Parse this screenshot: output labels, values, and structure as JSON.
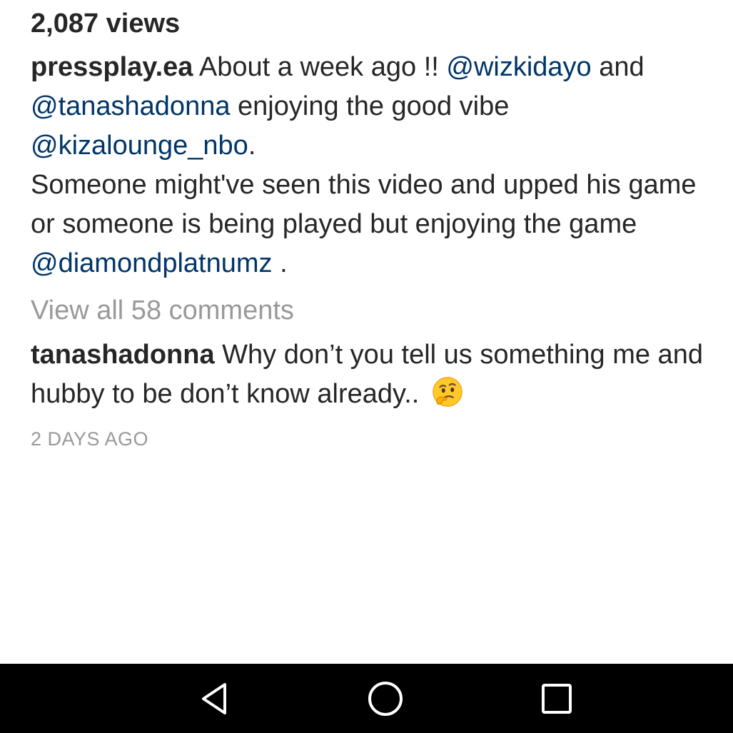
{
  "post": {
    "views": "2,087 views",
    "caption": {
      "username": "pressplay.ea",
      "text_1": " About a week ago !! ",
      "mention_1": "@wizkidayo",
      "text_2": " and ",
      "mention_2": "@tanashadonna",
      "text_3": " enjoying the good vibe ",
      "mention_3": "@kizalounge_nbo",
      "text_4": ".",
      "text_5": "Someone might've seen this video and upped his game or someone is being played but enjoying the game ",
      "mention_4": "@diamondplatnumz",
      "text_6": " ."
    },
    "view_all_comments": "View all 58 comments",
    "top_comment": {
      "username": "tanashadonna",
      "text": " Why don’t you tell us something me and hubby to be don’t know already.. ",
      "emoji": "thinking-face-emoji"
    },
    "timestamp": "2 DAYS AGO"
  },
  "navbar": {
    "back": "back-triangle-icon",
    "home": "home-circle-icon",
    "recents": "recents-square-icon"
  },
  "colors": {
    "text": "#262626",
    "mention": "#003569",
    "muted": "#999999",
    "navbar_bg": "#000000",
    "navbar_icon": "#ffffff"
  }
}
